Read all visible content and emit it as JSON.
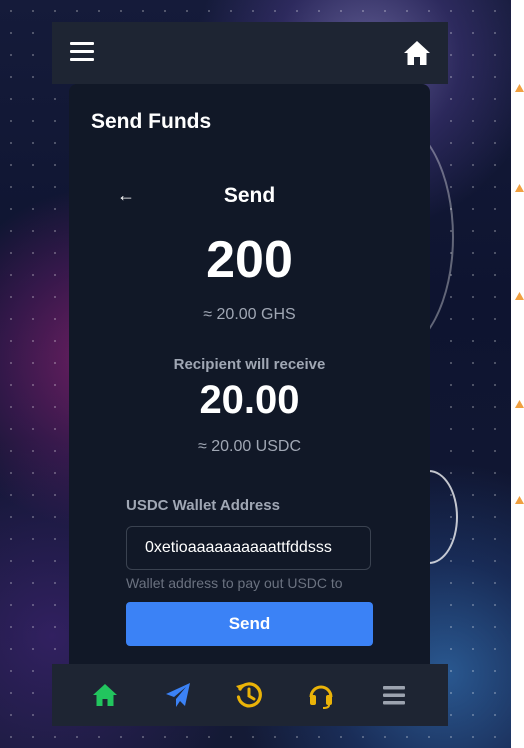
{
  "header": {
    "menu_icon": "hamburger-icon",
    "home_icon": "home-icon"
  },
  "card": {
    "title": "Send Funds",
    "back_arrow": "←",
    "heading": "Send",
    "amount": "200",
    "amount_approx": "≈ 20.00 GHS",
    "receive_label": "Recipient will receive",
    "receive_amount": "20.00",
    "receive_approx": "≈ 20.00 USDC",
    "wallet_label": "USDC Wallet Address",
    "wallet_value": "0xetioaaaaaaaaaattfddsss",
    "wallet_help": "Wallet address to pay out USDC to",
    "send_button": "Send"
  },
  "bottom_nav": [
    {
      "icon": "home-icon",
      "color": "#22c55e"
    },
    {
      "icon": "paper-plane-icon",
      "color": "#3b82f6"
    },
    {
      "icon": "history-icon",
      "color": "#eab308"
    },
    {
      "icon": "headset-icon",
      "color": "#eab308"
    },
    {
      "icon": "menu-icon",
      "color": "#9ca3af"
    }
  ],
  "colors": {
    "accent": "#3b82f6",
    "card_bg": "#111827",
    "bar_bg": "#1e2533"
  }
}
